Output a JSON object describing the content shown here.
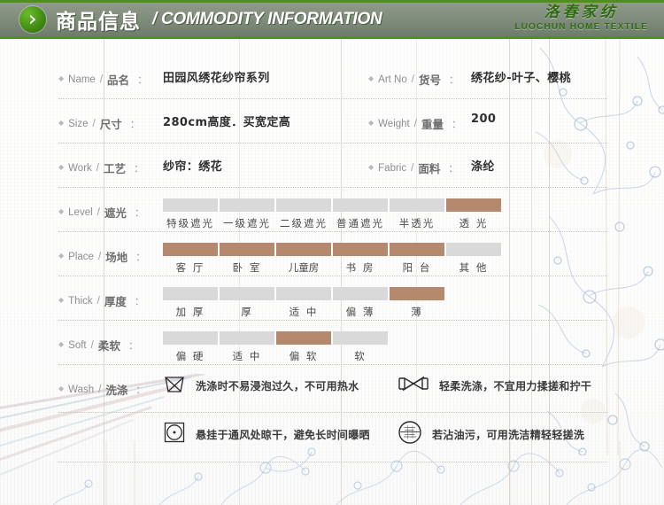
{
  "header": {
    "badge_icon": "chevron-right-icon",
    "title_cn": "商品信息",
    "title_en": "/ COMMODITY INFORMATION",
    "accent_color": "#4e8f1d",
    "bar_color": "#818d7d",
    "brand_cn": "洛春家纺",
    "brand_en": "LUOCHUN HOME TEXTILE",
    "brand_color": "#2f6b12"
  },
  "theme": {
    "selected_swatch_color": "#b4896d",
    "unselected_swatch_color": "#d9d9d9",
    "label_color": "#8e8e8e",
    "value_color": "#2f2f2f"
  },
  "spec": {
    "colon": "：",
    "slash": "/",
    "rows": [
      {
        "left": {
          "en": "Name",
          "cn": "品名",
          "value": "田园风绣花纱帘系列"
        },
        "right": {
          "en": "Art No",
          "cn": "货号",
          "value": "绣花纱-叶子、樱桃"
        }
      },
      {
        "left": {
          "en": "Size",
          "cn": "尺寸",
          "value": "280cm高度．买宽定高"
        },
        "right": {
          "en": "Weight",
          "cn": "重量",
          "value": "200"
        }
      },
      {
        "left": {
          "en": "Work",
          "cn": "工艺",
          "value": "纱帘：绣花"
        },
        "right": {
          "en": "Fabric",
          "cn": "面料",
          "value": "涤纶"
        }
      }
    ],
    "scales": [
      {
        "en": "Level",
        "cn": "遮光",
        "options": [
          {
            "label": "特级遮光",
            "selected": false
          },
          {
            "label": "一级遮光",
            "selected": false
          },
          {
            "label": "二级遮光",
            "selected": false
          },
          {
            "label": "普通遮光",
            "selected": false
          },
          {
            "label": "半透光",
            "selected": false
          },
          {
            "label": "透 光",
            "selected": true
          }
        ]
      },
      {
        "en": "Place",
        "cn": "场地",
        "options": [
          {
            "label": "客 厅",
            "selected": true
          },
          {
            "label": "卧 室",
            "selected": true
          },
          {
            "label": "儿童房",
            "selected": true
          },
          {
            "label": "书 房",
            "selected": true
          },
          {
            "label": "阳 台",
            "selected": true
          },
          {
            "label": "其 他",
            "selected": false
          }
        ]
      },
      {
        "en": "Thick",
        "cn": "厚度",
        "options": [
          {
            "label": "加 厚",
            "selected": false
          },
          {
            "label": "厚",
            "selected": false
          },
          {
            "label": "适 中",
            "selected": false
          },
          {
            "label": "偏 薄",
            "selected": false
          },
          {
            "label": "薄",
            "selected": true
          }
        ]
      },
      {
        "en": "Soft",
        "cn": "柔软",
        "options": [
          {
            "label": "偏 硬",
            "selected": false
          },
          {
            "label": "适 中",
            "selected": false
          },
          {
            "label": "偏 软",
            "selected": true
          },
          {
            "label": "软",
            "selected": false
          }
        ]
      }
    ],
    "wash": {
      "en": "Wash",
      "cn": "洗涤",
      "instructions": [
        {
          "icon": "no-soak-washtub-crossed-icon",
          "text": "洗涤时不易浸泡过久，不可用热水"
        },
        {
          "icon": "no-wring-crossed-icon",
          "text": "轻柔洗涤，不宜用力揉搓和拧干"
        },
        {
          "icon": "dry-in-shade-square-dot-icon",
          "text": "悬挂于通风处晾干，避免长时间曝晒"
        },
        {
          "icon": "dry-clean-circle-icon",
          "text": "若沾油污，可用洗洁精轻轻搓洗"
        }
      ]
    }
  }
}
